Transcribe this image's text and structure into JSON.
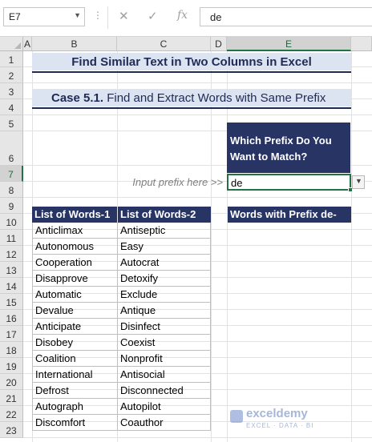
{
  "formula_bar": {
    "name_box": "E7",
    "cancel_icon": "✕",
    "enter_icon": "✓",
    "fx_icon": "fx",
    "formula": "de"
  },
  "columns": [
    "A",
    "B",
    "C",
    "D",
    "E"
  ],
  "rows": [
    "1",
    "2",
    "3",
    "4",
    "5",
    "6",
    "7",
    "8",
    "9",
    "10",
    "11",
    "12",
    "13",
    "14",
    "15",
    "16",
    "17",
    "18",
    "19",
    "20",
    "21",
    "22",
    "23"
  ],
  "selected_cell": {
    "column": "E",
    "row": "7"
  },
  "sheet": {
    "title": "Find Similar Text in Two Columns in Excel",
    "case_label": "Case 5.1.",
    "case_text": " Find and Extract Words with Same Prefix",
    "prompt_question": "Which Prefix Do You Want to Match?",
    "input_hint": "Input prefix here >>",
    "prefix_value": "de",
    "table": {
      "headers": [
        "List of Words-1",
        "List of Words-2"
      ],
      "rows": [
        [
          "Anticlimax",
          "Antiseptic"
        ],
        [
          "Autonomous",
          "Easy"
        ],
        [
          "Cooperation",
          "Autocrat"
        ],
        [
          "Disapprove",
          "Detoxify"
        ],
        [
          "Automatic",
          "Exclude"
        ],
        [
          "Devalue",
          "Antique"
        ],
        [
          "Anticipate",
          "Disinfect"
        ],
        [
          "Disobey",
          "Coexist"
        ],
        [
          "Coalition",
          "Nonprofit"
        ],
        [
          "International",
          "Antisocial"
        ],
        [
          "Defrost",
          "Disconnected"
        ],
        [
          "Autograph",
          "Autopilot"
        ],
        [
          "Discomfort",
          "Coauthor"
        ]
      ]
    },
    "result_header": "Words with Prefix de-"
  },
  "watermark": {
    "name": "exceldemy",
    "tagline": "EXCEL · DATA · BI"
  },
  "colors": {
    "header_fill": "#283464",
    "band_fill": "#dce3f1",
    "title_text": "#1f2a55",
    "selection": "#217346"
  }
}
